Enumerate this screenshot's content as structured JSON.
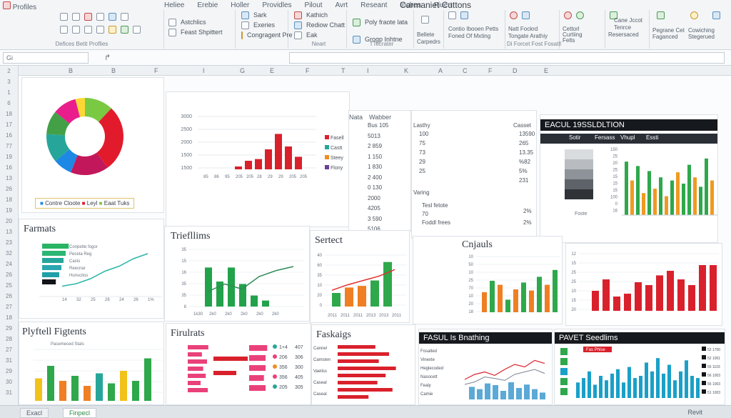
{
  "ribbon": {
    "tabs": [
      "Heliee",
      "Erebie",
      "Holler",
      "Providles",
      "Pilout",
      "Avrt",
      "Reseant",
      "Inches",
      "Fiuert"
    ],
    "title_fragment": "Carmaniet Cuttons",
    "file_label": "Profiles",
    "group1_label": "Defices Betit Proflies",
    "clip_items": [
      "Astchlics",
      "Feast Shpittert"
    ],
    "font_items": [
      "Sark",
      "Exeries",
      "Congragent Pre"
    ],
    "insert_items": [
      "Kathich",
      "Rediow Chatt",
      "Eak"
    ],
    "insert_label": "Neart",
    "style_items": [
      "Poly fraote lata",
      "Grogp Inhtne"
    ],
    "style_label": "TTecrater",
    "cells_items": [
      "Bellete",
      "Carpedrs"
    ],
    "view_items": [
      "Contio Ibooen Petts",
      "Foned Of Mxting"
    ],
    "data_items": [
      "Sueted",
      "Fiees"
    ],
    "addin_items": [
      "Natt Fockrd",
      "Tongate Arathiy"
    ],
    "addin_label": "Di Forcet Fost Fosatll",
    "analyze_items": [
      "Cettorl",
      "Curtiing",
      "Felts"
    ],
    "right_items": [
      "Cane Jccot",
      "Tenrce",
      "Resersaced"
    ],
    "far_right_items": [
      "Pegrane Cet",
      "Faganced",
      "Cowiching",
      "Stegerued"
    ]
  },
  "formula_bar": {
    "name_box": "Gi",
    "fx": "↱"
  },
  "columns": [
    "B",
    "B",
    "F",
    "I",
    "G",
    "E",
    "F",
    "T",
    "I",
    "K",
    "A",
    "C",
    "F",
    "D",
    "E"
  ],
  "rows": [
    "2",
    "3",
    "1",
    "6",
    "18",
    "17",
    "16",
    "77",
    "19",
    "16",
    "13",
    "26",
    "18",
    "19",
    "20",
    "13",
    "23",
    "32",
    "24",
    "26",
    "25",
    "26",
    "27",
    "18",
    "29",
    "28",
    "27",
    "31",
    "29",
    "30",
    "31"
  ],
  "donut": {
    "legend": [
      "Contre Cloote",
      "Leyl",
      "Eaat Tuks"
    ],
    "slices": [
      {
        "value": 12,
        "color": "#7ac943"
      },
      {
        "value": 28,
        "color": "#e21b2c"
      },
      {
        "value": 16,
        "color": "#c2185b"
      },
      {
        "value": 8,
        "color": "#1e88e5"
      },
      {
        "value": 12,
        "color": "#26a69a"
      },
      {
        "value": 10,
        "color": "#43a047"
      },
      {
        "value": 10,
        "color": "#e91e8c"
      },
      {
        "value": 4,
        "color": "#fdd835"
      }
    ]
  },
  "top_bar": {
    "yticks": [
      "3000",
      "2500",
      "2000",
      "1500",
      "1500"
    ],
    "xticks": [
      "85",
      "86",
      "95",
      "205",
      "205",
      "28",
      "29",
      "29",
      "205",
      "205"
    ],
    "values": [
      0.05,
      0.15,
      0.18,
      0.35,
      0.62,
      0.4,
      0.22
    ],
    "color": "#d9212c",
    "legend": [
      {
        "label": "Fasell",
        "color": "#d9212c"
      },
      {
        "label": "Castt",
        "color": "#26a69a"
      },
      {
        "label": "Steey",
        "color": "#ef8d22"
      },
      {
        "label": "Flony",
        "color": "#6a3d9a"
      }
    ]
  },
  "table": {
    "header_left": "Nata",
    "header": "Wabber",
    "rows": [
      "Bus 105",
      "5013",
      "2 859",
      "1 150",
      "1 830",
      "2 400",
      "0 130",
      "2000",
      "4205",
      "3 590",
      "5106"
    ]
  },
  "table2": {
    "header": [
      "Lasthy",
      "Casset"
    ],
    "rows": [
      [
        "100",
        "13590"
      ],
      [
        "75",
        "265"
      ],
      [
        "73",
        "13.35"
      ],
      [
        "29",
        "%82"
      ],
      [
        "25",
        "5%"
      ],
      [
        "",
        "231"
      ]
    ],
    "extra": [
      "Varing",
      "Tesl fetote",
      "70",
      "Foddl frees"
    ],
    "extra_vals": [
      "2%",
      "2%"
    ]
  },
  "exel_panel": {
    "title": "EACUL 19SSLDLTION",
    "tabs": [
      "Sotir",
      "Fersass",
      "Vhupl",
      "Essti"
    ],
    "gray_label": "Foste",
    "yticks": [
      "150",
      "25",
      "20",
      "25",
      "15",
      "15",
      "15",
      "100",
      "0",
      "16"
    ],
    "bars": [
      {
        "v": 0.85,
        "c": "#2ea84b"
      },
      {
        "v": 0.55,
        "c": "#ef9a22"
      },
      {
        "v": 0.78,
        "c": "#2ea84b"
      },
      {
        "v": 0.35,
        "c": "#ef9a22"
      },
      {
        "v": 0.7,
        "c": "#2ea84b"
      },
      {
        "v": 0.42,
        "c": "#ef9a22"
      },
      {
        "v": 0.6,
        "c": "#2ea84b"
      },
      {
        "v": 0.3,
        "c": "#ef9a22"
      },
      {
        "v": 0.55,
        "c": "#2ea84b"
      },
      {
        "v": 0.68,
        "c": "#ef9a22"
      },
      {
        "v": 0.5,
        "c": "#2ea84b"
      },
      {
        "v": 0.8,
        "c": "#2ea84b"
      },
      {
        "v": 0.6,
        "c": "#ef9a22"
      },
      {
        "v": 0.45,
        "c": "#2ea84b"
      },
      {
        "v": 0.9,
        "c": "#2ea84b"
      },
      {
        "v": 0.55,
        "c": "#ef9a22"
      }
    ]
  },
  "formats": {
    "title": "Farmats",
    "legend": [
      "Conpette fogor",
      "Peceta Reg",
      "Casts",
      "Reecnar",
      "Hunscitos"
    ],
    "bars": [
      {
        "v": 0.62,
        "c": "#28b463"
      },
      {
        "v": 0.55,
        "c": "#2bb673"
      },
      {
        "v": 0.5,
        "c": "#26a69a"
      },
      {
        "v": 0.45,
        "c": "#2aa7b0"
      },
      {
        "v": 0.4,
        "c": "#1fa0a8"
      },
      {
        "v": 0.32,
        "c": "#111418"
      }
    ],
    "line": [
      0.85,
      0.8,
      0.7,
      0.55,
      0.45,
      0.3,
      0.2
    ],
    "xticks": [
      "14",
      "32",
      "25",
      "28",
      "24",
      "26",
      "1%"
    ]
  },
  "triefllims": {
    "title": "Triefllims",
    "yticks": [
      "35",
      "15",
      "16",
      "35",
      "35",
      "8"
    ],
    "xticks": [
      "1k30",
      "2k0",
      "2k0",
      "2k0",
      "2k0",
      "2k0"
    ],
    "bars": [
      0.78,
      0.5,
      0.78,
      0.45,
      0.22,
      0.12
    ],
    "line": [
      0.3,
      0.45,
      0.35,
      0.6,
      0.72,
      0.8
    ]
  },
  "sertect": {
    "title": "Sertect",
    "yticks": [
      "40",
      "60",
      "35",
      "10",
      "20",
      "0"
    ],
    "xticks": [
      "2011",
      "2011",
      "2011",
      "2013",
      "2013",
      "2011"
    ],
    "bars": [
      {
        "v": 0.25,
        "c": "#2ea84b"
      },
      {
        "v": 0.35,
        "c": "#ef7f22"
      },
      {
        "v": 0.38,
        "c": "#ef7f22"
      },
      {
        "v": 0.48,
        "c": "#2ea84b"
      },
      {
        "v": 0.82,
        "c": "#2ea84b"
      }
    ],
    "line": [
      0.3,
      0.4,
      0.48,
      0.56,
      0.68
    ]
  },
  "cnjauls": {
    "title": "Cnjauls",
    "yticks": [
      "10",
      "50",
      "10",
      "25",
      "70",
      "10",
      "20",
      "18"
    ],
    "bars": [
      {
        "v": 0.35,
        "c": "#ef7f22"
      },
      {
        "v": 0.55,
        "c": "#2ea84b"
      },
      {
        "v": 0.48,
        "c": "#ef7f22"
      },
      {
        "v": 0.22,
        "c": "#2ea84b"
      },
      {
        "v": 0.4,
        "c": "#ef7f22"
      },
      {
        "v": 0.52,
        "c": "#2ea84b"
      },
      {
        "v": 0.38,
        "c": "#ef7f22"
      },
      {
        "v": 0.62,
        "c": "#2ea84b"
      },
      {
        "v": 0.48,
        "c": "#ef7f22"
      },
      {
        "v": 0.74,
        "c": "#2ea84b"
      }
    ]
  },
  "red_chart": {
    "yticks": [
      "12",
      "15",
      "25",
      "25",
      "10",
      "15",
      "20"
    ],
    "bars": [
      0.35,
      0.55,
      0.25,
      0.3,
      0.5,
      0.45,
      0.62,
      0.7,
      0.55,
      0.45,
      0.8,
      0.8
    ]
  },
  "pivot_figments": {
    "title": "Plyftell Figtents",
    "legend": "Pacemeced Stals",
    "bars": [
      {
        "v": 0.45,
        "c": "#f2c21b"
      },
      {
        "v": 0.7,
        "c": "#2ea84b"
      },
      {
        "v": 0.4,
        "c": "#ef7f22"
      },
      {
        "v": 0.5,
        "c": "#2ea84b"
      },
      {
        "v": 0.3,
        "c": "#ef7f22"
      },
      {
        "v": 0.55,
        "c": "#26a69a"
      },
      {
        "v": 0.35,
        "c": "#2ea84b"
      },
      {
        "v": 0.6,
        "c": "#f2c21b"
      },
      {
        "v": 0.4,
        "c": "#2ea84b"
      },
      {
        "v": 0.85,
        "c": "#2ea84b"
      }
    ]
  },
  "figulrats": {
    "title": "Firulrats",
    "bars": [
      0.8,
      0.55,
      0.75,
      0.6,
      0.7,
      0.5,
      0.78
    ],
    "mid_bars": [
      0.6,
      0.4
    ],
    "right_bars": [
      0.55,
      0.5,
      0.5,
      0.45,
      0.5
    ],
    "labels": [
      "1+4",
      "206",
      "356",
      "356",
      "205"
    ],
    "values": [
      "407",
      "306",
      "300",
      "405",
      "305"
    ],
    "dot_colors": [
      "#26a69a",
      "#e9417a",
      "#ef8d22",
      "#e9417a",
      "#26a69a"
    ]
  },
  "faskaigs": {
    "title": "Faskaigs",
    "labels": [
      "Cannel",
      "Camsten",
      "Vaeliss",
      "Caseal",
      "Caseal"
    ],
    "values": [
      0.55,
      0.75,
      0.6,
      0.85,
      0.7,
      0.58,
      0.8,
      0.45
    ]
  },
  "fasul": {
    "title": "FASUL Is Bnathing",
    "labels": [
      "Fosalted",
      "Vinexte",
      "Heglecoded",
      "Nasocett",
      "Fealy",
      "Camie"
    ],
    "line_red": [
      0.4,
      0.5,
      0.55,
      0.48,
      0.6,
      0.7,
      0.65,
      0.78,
      0.72
    ],
    "line_gray": [
      0.3,
      0.35,
      0.45,
      0.42,
      0.38,
      0.5,
      0.55,
      0.6,
      0.52
    ],
    "bars": [
      0.22,
      0.18,
      0.28,
      0.25,
      0.15,
      0.3,
      0.2,
      0.26,
      0.18,
      0.12
    ]
  },
  "pivet": {
    "title": "PAVET Seedlims",
    "tag": "Fas Phlse",
    "bars": [
      0.35,
      0.45,
      0.6,
      0.3,
      0.5,
      0.4,
      0.55,
      0.65,
      0.35,
      0.7,
      0.45,
      0.5,
      0.8,
      0.6,
      0.9,
      0.55,
      0.75,
      0.4,
      0.6,
      0.85,
      0.5,
      0.45
    ],
    "side": [
      "52 1700",
      "52 1001",
      "55 1103",
      "56 1003",
      "55 1003",
      "51 1003"
    ]
  },
  "sheet_tabs": [
    "Exacl",
    "Finpecl"
  ],
  "status": "Revit"
}
